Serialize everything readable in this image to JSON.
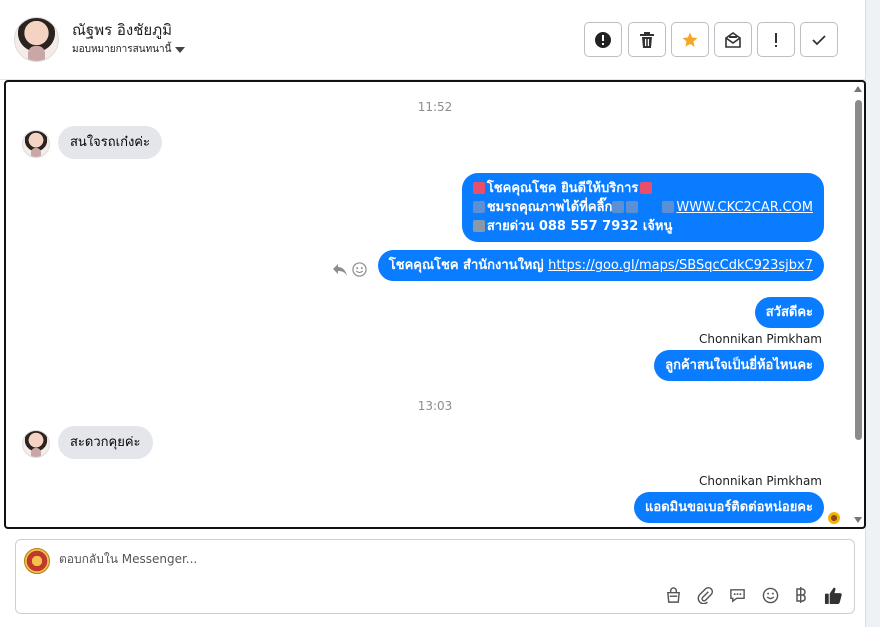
{
  "header": {
    "contact_name": "ณัฐพร อิงชัยภูมิ",
    "assign_label": "มอบหมายการสนทนานี้",
    "buttons": [
      "spam-icon",
      "trash-icon",
      "star-icon",
      "mark-unread-icon",
      "follow-up-icon",
      "done-icon"
    ]
  },
  "chat": {
    "time_1": "11:52",
    "time_2": "13:03",
    "msg_in_1": "สนใจรถเก๋งค่ะ",
    "msg_out_1": {
      "line1": "โชคคุณโชค ยินดีให้บริการ",
      "line2_text": "ชมรถคุณภาพได้ที่คลิ๊ก",
      "line2_link": "WWW.CKC2CAR.COM",
      "line3": "สายด่วน 088 557 7932 เจ้หนู"
    },
    "msg_out_2": {
      "text": "โชคคุณโชค สำนักงานใหญ่ ",
      "link": "https://goo.gl/maps/SBSqcCdkC923sjbx7"
    },
    "msg_out_3": "สวัสดีคะ",
    "sender_1": "Chonnikan Pimkham",
    "msg_out_4": "ลูกค้าสนใจเป็นยี่ห้อไหนคะ",
    "msg_in_2": "สะดวกคุยค่ะ",
    "sender_2": "Chonnikan Pimkham",
    "msg_out_5": "แอดมินขอเบอร์ติดต่อหน่อยคะ"
  },
  "composer": {
    "placeholder": "ตอบกลับใน Messenger...",
    "tools": [
      "shop-bag-icon",
      "attachment-icon",
      "saved-reply-icon",
      "emoji-icon",
      "baht-icon",
      "thumbs-up-icon"
    ]
  },
  "colors": {
    "outgoing_bubble": "#0a7cff",
    "incoming_bubble": "#e4e6eb",
    "star": "#f5a623"
  }
}
